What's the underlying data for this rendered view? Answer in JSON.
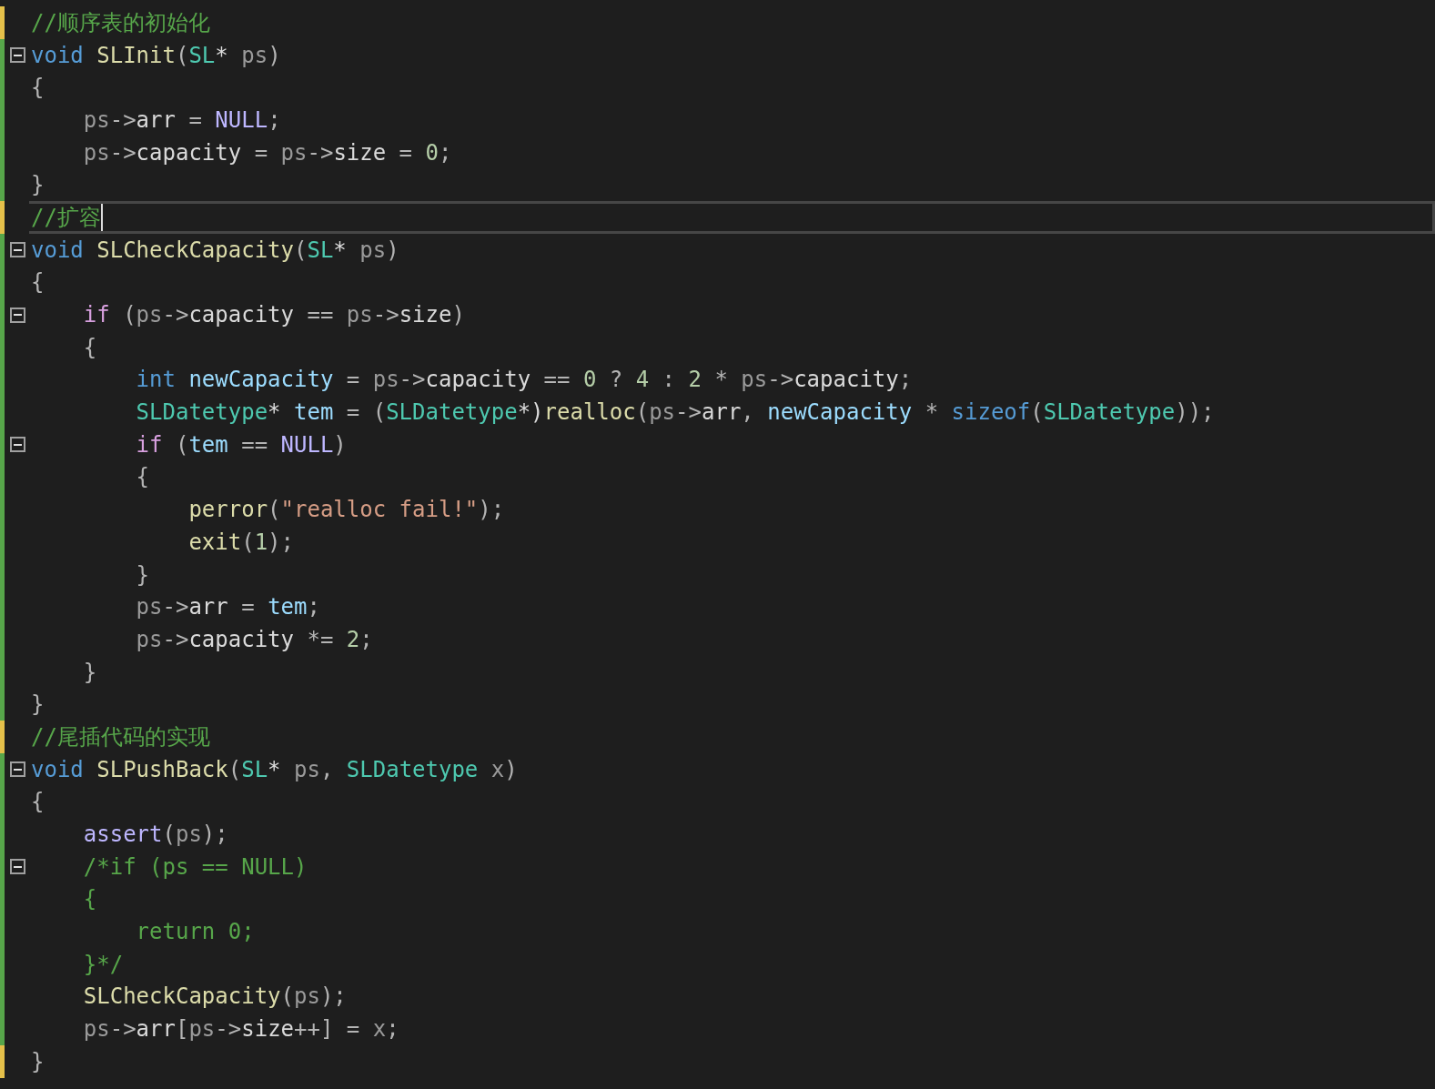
{
  "editor": {
    "lines": [
      {
        "unsaved": true,
        "foldable": false,
        "current": false,
        "cursor": false,
        "tokens": [
          {
            "kind": "comment",
            "text": "//顺序表的初始化"
          }
        ]
      },
      {
        "unsaved": false,
        "foldable": true,
        "current": false,
        "cursor": false,
        "tokens": [
          {
            "kind": "keyword",
            "text": "void"
          },
          {
            "kind": "func",
            "text": " SLInit"
          },
          {
            "kind": "punct",
            "text": "("
          },
          {
            "kind": "type",
            "text": "SL"
          },
          {
            "kind": "plain",
            "text": "* "
          },
          {
            "kind": "param",
            "text": "ps"
          },
          {
            "kind": "punct",
            "text": ")"
          }
        ]
      },
      {
        "unsaved": false,
        "foldable": false,
        "current": false,
        "cursor": false,
        "tokens": [
          {
            "kind": "punct",
            "text": "{"
          }
        ]
      },
      {
        "unsaved": false,
        "foldable": false,
        "current": false,
        "cursor": false,
        "tokens": [
          {
            "kind": "param",
            "text": "    ps"
          },
          {
            "kind": "punct",
            "text": "->"
          },
          {
            "kind": "member",
            "text": "arr"
          },
          {
            "kind": "punct",
            "text": " = "
          },
          {
            "kind": "macro",
            "text": "NULL"
          },
          {
            "kind": "punct",
            "text": ";"
          }
        ]
      },
      {
        "unsaved": false,
        "foldable": false,
        "current": false,
        "cursor": false,
        "tokens": [
          {
            "kind": "param",
            "text": "    ps"
          },
          {
            "kind": "punct",
            "text": "->"
          },
          {
            "kind": "member",
            "text": "capacity"
          },
          {
            "kind": "punct",
            "text": " = "
          },
          {
            "kind": "param",
            "text": "ps"
          },
          {
            "kind": "punct",
            "text": "->"
          },
          {
            "kind": "member",
            "text": "size"
          },
          {
            "kind": "punct",
            "text": " = "
          },
          {
            "kind": "number",
            "text": "0"
          },
          {
            "kind": "punct",
            "text": ";"
          }
        ]
      },
      {
        "unsaved": false,
        "foldable": false,
        "current": false,
        "cursor": false,
        "tokens": [
          {
            "kind": "punct",
            "text": "}"
          }
        ]
      },
      {
        "unsaved": true,
        "foldable": false,
        "current": true,
        "cursor": true,
        "tokens": [
          {
            "kind": "comment",
            "text": "//扩容"
          }
        ]
      },
      {
        "unsaved": false,
        "foldable": true,
        "current": false,
        "cursor": false,
        "tokens": [
          {
            "kind": "keyword",
            "text": "void"
          },
          {
            "kind": "func",
            "text": " SLCheckCapacity"
          },
          {
            "kind": "punct",
            "text": "("
          },
          {
            "kind": "type",
            "text": "SL"
          },
          {
            "kind": "plain",
            "text": "* "
          },
          {
            "kind": "param",
            "text": "ps"
          },
          {
            "kind": "punct",
            "text": ")"
          }
        ]
      },
      {
        "unsaved": false,
        "foldable": false,
        "current": false,
        "cursor": false,
        "tokens": [
          {
            "kind": "punct",
            "text": "{"
          }
        ]
      },
      {
        "unsaved": false,
        "foldable": true,
        "current": false,
        "cursor": false,
        "tokens": [
          {
            "kind": "control",
            "text": "    if"
          },
          {
            "kind": "punct",
            "text": " ("
          },
          {
            "kind": "param",
            "text": "ps"
          },
          {
            "kind": "punct",
            "text": "->"
          },
          {
            "kind": "member",
            "text": "capacity"
          },
          {
            "kind": "punct",
            "text": " == "
          },
          {
            "kind": "param",
            "text": "ps"
          },
          {
            "kind": "punct",
            "text": "->"
          },
          {
            "kind": "member",
            "text": "size"
          },
          {
            "kind": "punct",
            "text": ")"
          }
        ]
      },
      {
        "unsaved": false,
        "foldable": false,
        "current": false,
        "cursor": false,
        "tokens": [
          {
            "kind": "punct",
            "text": "    {"
          }
        ]
      },
      {
        "unsaved": false,
        "foldable": false,
        "current": false,
        "cursor": false,
        "tokens": [
          {
            "kind": "keyword",
            "text": "        int"
          },
          {
            "kind": "local",
            "text": " newCapacity"
          },
          {
            "kind": "punct",
            "text": " = "
          },
          {
            "kind": "param",
            "text": "ps"
          },
          {
            "kind": "punct",
            "text": "->"
          },
          {
            "kind": "member",
            "text": "capacity"
          },
          {
            "kind": "punct",
            "text": " == "
          },
          {
            "kind": "number",
            "text": "0"
          },
          {
            "kind": "punct",
            "text": " ? "
          },
          {
            "kind": "number",
            "text": "4"
          },
          {
            "kind": "punct",
            "text": " : "
          },
          {
            "kind": "number",
            "text": "2"
          },
          {
            "kind": "punct",
            "text": " * "
          },
          {
            "kind": "param",
            "text": "ps"
          },
          {
            "kind": "punct",
            "text": "->"
          },
          {
            "kind": "member",
            "text": "capacity"
          },
          {
            "kind": "punct",
            "text": ";"
          }
        ]
      },
      {
        "unsaved": false,
        "foldable": false,
        "current": false,
        "cursor": false,
        "tokens": [
          {
            "kind": "type",
            "text": "        SLDatetype"
          },
          {
            "kind": "plain",
            "text": "* "
          },
          {
            "kind": "local",
            "text": "tem"
          },
          {
            "kind": "punct",
            "text": " = ("
          },
          {
            "kind": "type",
            "text": "SLDatetype"
          },
          {
            "kind": "plain",
            "text": "*)"
          },
          {
            "kind": "func",
            "text": "realloc"
          },
          {
            "kind": "punct",
            "text": "("
          },
          {
            "kind": "param",
            "text": "ps"
          },
          {
            "kind": "punct",
            "text": "->"
          },
          {
            "kind": "member",
            "text": "arr"
          },
          {
            "kind": "punct",
            "text": ", "
          },
          {
            "kind": "local",
            "text": "newCapacity"
          },
          {
            "kind": "punct",
            "text": " * "
          },
          {
            "kind": "keyword",
            "text": "sizeof"
          },
          {
            "kind": "punct",
            "text": "("
          },
          {
            "kind": "type",
            "text": "SLDatetype"
          },
          {
            "kind": "punct",
            "text": "));"
          }
        ]
      },
      {
        "unsaved": false,
        "foldable": true,
        "current": false,
        "cursor": false,
        "tokens": [
          {
            "kind": "control",
            "text": "        if"
          },
          {
            "kind": "punct",
            "text": " ("
          },
          {
            "kind": "local",
            "text": "tem"
          },
          {
            "kind": "punct",
            "text": " == "
          },
          {
            "kind": "macro",
            "text": "NULL"
          },
          {
            "kind": "punct",
            "text": ")"
          }
        ]
      },
      {
        "unsaved": false,
        "foldable": false,
        "current": false,
        "cursor": false,
        "tokens": [
          {
            "kind": "punct",
            "text": "        {"
          }
        ]
      },
      {
        "unsaved": false,
        "foldable": false,
        "current": false,
        "cursor": false,
        "tokens": [
          {
            "kind": "func",
            "text": "            perror"
          },
          {
            "kind": "punct",
            "text": "("
          },
          {
            "kind": "string",
            "text": "\"realloc fail!\""
          },
          {
            "kind": "punct",
            "text": ");"
          }
        ]
      },
      {
        "unsaved": false,
        "foldable": false,
        "current": false,
        "cursor": false,
        "tokens": [
          {
            "kind": "func",
            "text": "            exit"
          },
          {
            "kind": "punct",
            "text": "("
          },
          {
            "kind": "number",
            "text": "1"
          },
          {
            "kind": "punct",
            "text": ");"
          }
        ]
      },
      {
        "unsaved": false,
        "foldable": false,
        "current": false,
        "cursor": false,
        "tokens": [
          {
            "kind": "punct",
            "text": "        }"
          }
        ]
      },
      {
        "unsaved": false,
        "foldable": false,
        "current": false,
        "cursor": false,
        "tokens": [
          {
            "kind": "param",
            "text": "        ps"
          },
          {
            "kind": "punct",
            "text": "->"
          },
          {
            "kind": "member",
            "text": "arr"
          },
          {
            "kind": "punct",
            "text": " = "
          },
          {
            "kind": "local",
            "text": "tem"
          },
          {
            "kind": "punct",
            "text": ";"
          }
        ]
      },
      {
        "unsaved": false,
        "foldable": false,
        "current": false,
        "cursor": false,
        "tokens": [
          {
            "kind": "param",
            "text": "        ps"
          },
          {
            "kind": "punct",
            "text": "->"
          },
          {
            "kind": "member",
            "text": "capacity"
          },
          {
            "kind": "punct",
            "text": " *= "
          },
          {
            "kind": "number",
            "text": "2"
          },
          {
            "kind": "punct",
            "text": ";"
          }
        ]
      },
      {
        "unsaved": false,
        "foldable": false,
        "current": false,
        "cursor": false,
        "tokens": [
          {
            "kind": "punct",
            "text": "    }"
          }
        ]
      },
      {
        "unsaved": false,
        "foldable": false,
        "current": false,
        "cursor": false,
        "tokens": [
          {
            "kind": "punct",
            "text": "}"
          }
        ]
      },
      {
        "unsaved": true,
        "foldable": false,
        "current": false,
        "cursor": false,
        "tokens": [
          {
            "kind": "comment",
            "text": "//尾插代码的实现"
          }
        ]
      },
      {
        "unsaved": false,
        "foldable": true,
        "current": false,
        "cursor": false,
        "tokens": [
          {
            "kind": "keyword",
            "text": "void"
          },
          {
            "kind": "func",
            "text": " SLPushBack"
          },
          {
            "kind": "punct",
            "text": "("
          },
          {
            "kind": "type",
            "text": "SL"
          },
          {
            "kind": "plain",
            "text": "* "
          },
          {
            "kind": "param",
            "text": "ps"
          },
          {
            "kind": "punct",
            "text": ", "
          },
          {
            "kind": "type",
            "text": "SLDatetype"
          },
          {
            "kind": "param",
            "text": " x"
          },
          {
            "kind": "punct",
            "text": ")"
          }
        ]
      },
      {
        "unsaved": false,
        "foldable": false,
        "current": false,
        "cursor": false,
        "tokens": [
          {
            "kind": "punct",
            "text": "{"
          }
        ]
      },
      {
        "unsaved": false,
        "foldable": false,
        "current": false,
        "cursor": false,
        "tokens": [
          {
            "kind": "macro",
            "text": "    assert"
          },
          {
            "kind": "punct",
            "text": "("
          },
          {
            "kind": "param",
            "text": "ps"
          },
          {
            "kind": "punct",
            "text": ");"
          }
        ]
      },
      {
        "unsaved": false,
        "foldable": true,
        "current": false,
        "cursor": false,
        "tokens": [
          {
            "kind": "comment",
            "text": "    /*if (ps == NULL)"
          }
        ]
      },
      {
        "unsaved": false,
        "foldable": false,
        "current": false,
        "cursor": false,
        "tokens": [
          {
            "kind": "comment",
            "text": "    {"
          }
        ]
      },
      {
        "unsaved": false,
        "foldable": false,
        "current": false,
        "cursor": false,
        "tokens": [
          {
            "kind": "comment",
            "text": "        return 0;"
          }
        ]
      },
      {
        "unsaved": false,
        "foldable": false,
        "current": false,
        "cursor": false,
        "tokens": [
          {
            "kind": "comment",
            "text": "    }*/"
          }
        ]
      },
      {
        "unsaved": false,
        "foldable": false,
        "current": false,
        "cursor": false,
        "tokens": [
          {
            "kind": "func",
            "text": "    SLCheckCapacity"
          },
          {
            "kind": "punct",
            "text": "("
          },
          {
            "kind": "param",
            "text": "ps"
          },
          {
            "kind": "punct",
            "text": ");"
          }
        ]
      },
      {
        "unsaved": false,
        "foldable": false,
        "current": false,
        "cursor": false,
        "tokens": [
          {
            "kind": "param",
            "text": "    ps"
          },
          {
            "kind": "punct",
            "text": "->"
          },
          {
            "kind": "member",
            "text": "arr"
          },
          {
            "kind": "punct",
            "text": "["
          },
          {
            "kind": "param",
            "text": "ps"
          },
          {
            "kind": "punct",
            "text": "->"
          },
          {
            "kind": "member",
            "text": "size"
          },
          {
            "kind": "punct",
            "text": "++] = "
          },
          {
            "kind": "param",
            "text": "x"
          },
          {
            "kind": "punct",
            "text": ";"
          }
        ]
      },
      {
        "unsaved": true,
        "foldable": false,
        "current": false,
        "cursor": false,
        "tokens": [
          {
            "kind": "punct",
            "text": "}"
          }
        ]
      }
    ]
  }
}
